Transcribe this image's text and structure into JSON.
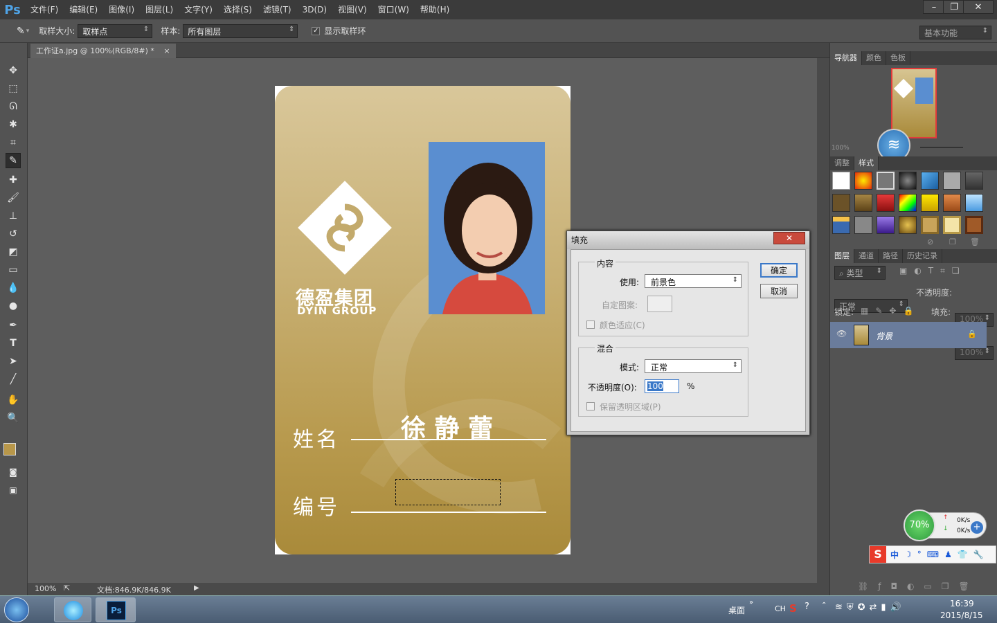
{
  "menubar": {
    "logo": "Ps",
    "items": [
      "文件(F)",
      "编辑(E)",
      "图像(I)",
      "图层(L)",
      "文字(Y)",
      "选择(S)",
      "滤镜(T)",
      "3D(D)",
      "视图(V)",
      "窗口(W)",
      "帮助(H)"
    ]
  },
  "window_controls": {
    "minimize": "–",
    "restore": "❐",
    "close": "✕"
  },
  "options": {
    "sample_size_label": "取样大小:",
    "sample_size_value": "取样点",
    "sample_label": "样本:",
    "sample_value": "所有图层",
    "show_ring_label": "显示取样环",
    "workspace_value": "基本功能"
  },
  "document": {
    "tab_title": "工作证a.jpg @ 100%(RGB/8#) *",
    "tab_close": "×"
  },
  "card": {
    "company_cn": "德盈集团",
    "company_en": "DYIN GROUP",
    "name_label": "姓名",
    "name_value": "徐 静 蕾",
    "number_label": "编号"
  },
  "status": {
    "zoom": "100%",
    "doc_size": "文档:846.9K/846.9K"
  },
  "dialog": {
    "title": "填充",
    "close": "✕",
    "content_group": "内容",
    "use_label": "使用:",
    "use_value": "前景色",
    "custom_pattern_label": "自定图案:",
    "color_adapt_label": "颜色适应(C)",
    "blend_group": "混合",
    "mode_label": "模式:",
    "mode_value": "正常",
    "opacity_label": "不透明度(O):",
    "opacity_value": "100",
    "opacity_unit": "%",
    "preserve_label": "保留透明区域(P)",
    "ok": "确定",
    "cancel": "取消"
  },
  "navigator": {
    "tabs": [
      "导航器",
      "颜色",
      "色板"
    ],
    "zoom": "100%"
  },
  "styles_panel": {
    "tabs": [
      "调整",
      "样式"
    ]
  },
  "layers": {
    "tabs": [
      "图层",
      "通道",
      "路径",
      "历史记录"
    ],
    "filter_label": "类型",
    "blend_mode": "正常",
    "opacity_label": "不透明度:",
    "opacity_value": "100%",
    "lock_label": "锁定:",
    "fill_label": "填充:",
    "fill_value": "100%",
    "layer_name": "背景"
  },
  "net_widget": {
    "percent": "70%",
    "up": "0K/s",
    "down": "0K/s"
  },
  "ime_bar": {
    "mode": "中"
  },
  "taskbar": {
    "desktop_label": "桌面",
    "lang": "CH",
    "time": "16:39",
    "date": "2015/8/15"
  },
  "colors": {
    "ps_bg": "#535353",
    "foreground": "#b8974a",
    "background": "#000000",
    "accent": "#4fa3e6"
  }
}
